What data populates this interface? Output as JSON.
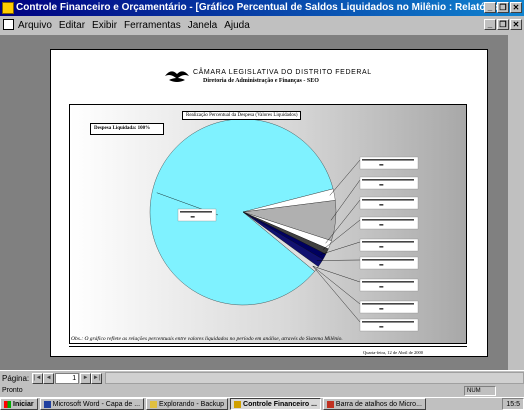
{
  "window": {
    "title": "Controle Financeiro e Orçamentário - [Gráfico Percentual de Saldos Liquidados no Milênio : Relatório]",
    "buttons": [
      "_",
      "❐",
      "✕"
    ],
    "doc_buttons": [
      "_",
      "❐",
      "✕"
    ]
  },
  "menu": {
    "items": [
      "Arquivo",
      "Editar",
      "Exibir",
      "Ferramentas",
      "Janela",
      "Ajuda"
    ]
  },
  "report": {
    "org_name": "CÂMARA LEGISLATIVA DO DISTRITO FEDERAL",
    "org_subtitle": "Diretoria de Administração e Finanças - SEO",
    "chart_title": "Realização Percentual da Despesa (Valores Liquidados)",
    "legend_label": "Despesa Liquidada: 100%",
    "note": "Obs.: O gráfico reflete as relações percentuais entre valores liquidados no período em análise, através do Sistema Milênio.",
    "date": "Quarta-feira, 12 de Abril de 2000"
  },
  "chart_data": {
    "type": "pie",
    "title": "Realização Percentual da Despesa (Valores Liquidados)",
    "slices": [
      {
        "value": 85.0,
        "color": "#7ff2ff"
      },
      {
        "value": 2.0,
        "color": "#ffffff"
      },
      {
        "value": 7.0,
        "color": "#b0b0b0"
      },
      {
        "value": 1.5,
        "color": "#ffffff"
      },
      {
        "value": 1.0,
        "color": "#404040"
      },
      {
        "value": 1.0,
        "color": "#000060"
      },
      {
        "value": 1.5,
        "color": "#101070"
      },
      {
        "value": 1.0,
        "color": "#e0e0e0"
      }
    ],
    "labels": [
      "",
      "",
      "",
      "",
      "",
      "",
      "",
      "",
      "",
      ""
    ],
    "legend": "top-left"
  },
  "navigation": {
    "label": "Página:",
    "first_icon": "|◄",
    "prev_icon": "◄",
    "page_value": "1",
    "next_icon": "►",
    "last_icon": "►|"
  },
  "status": {
    "text": "Pronto",
    "num": "NUM"
  },
  "taskbar": {
    "start": "Iniciar",
    "tasks": [
      "Microsoft Word - Capa de ...",
      "Explorando - Backup",
      "Controle Financeiro ...",
      "Barra de atalhos do Micro..."
    ],
    "clock": "15:5"
  },
  "colors": {
    "titlebar": "#000080",
    "workspace": "#808080",
    "pie_main": "#7ff2ff"
  }
}
